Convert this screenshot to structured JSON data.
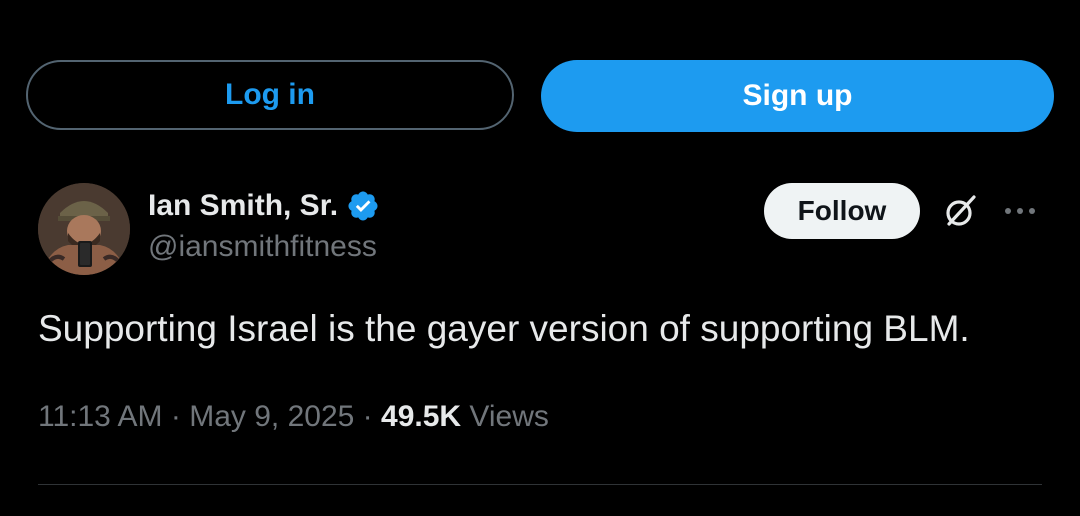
{
  "auth": {
    "login_label": "Log in",
    "signup_label": "Sign up"
  },
  "author": {
    "display_name": "Ian Smith, Sr.",
    "handle": "@iansmithfitness",
    "verified": true,
    "avatar_icon": "profile-photo"
  },
  "actions": {
    "follow_label": "Follow",
    "grok_icon": "grok-icon",
    "more_icon": "more-icon"
  },
  "tweet": {
    "text": "Supporting Israel is the gayer version of supporting BLM.",
    "time": "11:13 AM",
    "separator": "·",
    "date": "May 9, 2025",
    "views_count": "49.5K",
    "views_label": "Views"
  },
  "colors": {
    "background": "#000000",
    "accent": "#1d9bf0",
    "primary_text": "#e7e9ea",
    "secondary_text": "#71767b",
    "follow_bg": "#eff3f4"
  }
}
